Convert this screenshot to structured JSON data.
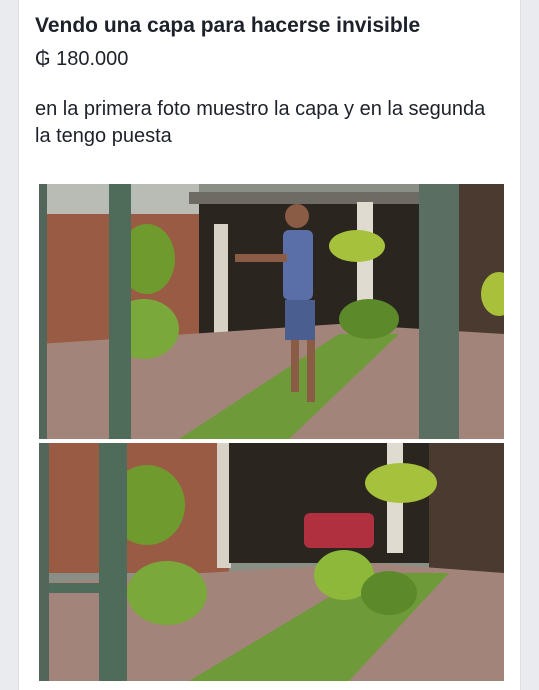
{
  "listing": {
    "title": "Vendo una capa para hacerse invisible",
    "price": "₲ 180.000",
    "description": "en la primera foto muestro la capa y en la segunda la tengo puesta"
  },
  "photos": [
    {
      "name": "photo-with-person"
    },
    {
      "name": "photo-empty-driveway"
    }
  ]
}
